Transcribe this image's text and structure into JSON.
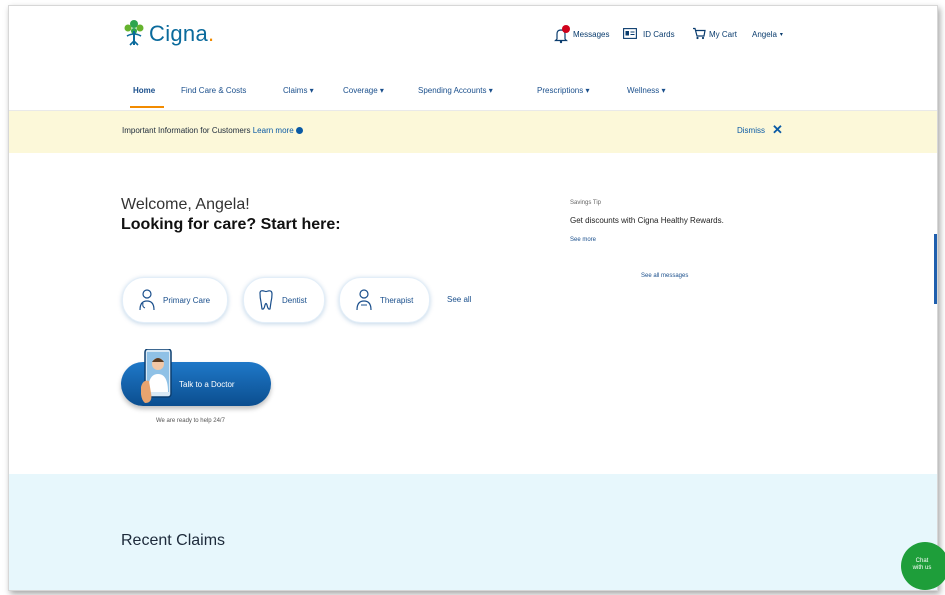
{
  "header": {
    "logo_text": "Cigna",
    "messages_label": "Messages",
    "idcards_label": "ID Cards",
    "cart_label": "My Cart",
    "user_label": "Angela"
  },
  "nav": {
    "items": [
      "Home",
      "Find Care & Costs",
      "Claims",
      "Coverage",
      "Spending Accounts",
      "Prescriptions",
      "Wellness"
    ]
  },
  "banner": {
    "text": "Important Information for Customers",
    "link": "Learn more",
    "dismiss": "Dismiss"
  },
  "welcome": {
    "greeting": "Welcome, Angela!",
    "headline": "Looking for care? Start here:"
  },
  "care": {
    "primary": "Primary Care",
    "dentist": "Dentist",
    "therapist": "Therapist",
    "see_all": "See all"
  },
  "talk": {
    "label": "Talk to a Doctor",
    "subtext": "We are ready to help 24/7"
  },
  "messages": {
    "title": "Savings Tip",
    "body": "Get discounts with Cigna Healthy Rewards.",
    "link": "See more",
    "see_all": "See all messages"
  },
  "claims": {
    "title": "Recent Claims"
  },
  "chat": {
    "label": "Chat with us"
  },
  "colors": {
    "brand_blue": "#0a6a9c",
    "accent_orange": "#f28b00",
    "banner_yellow": "#fcf8d9",
    "claims_bg": "#e7f7fc",
    "chat_green": "#1e9e3a"
  }
}
